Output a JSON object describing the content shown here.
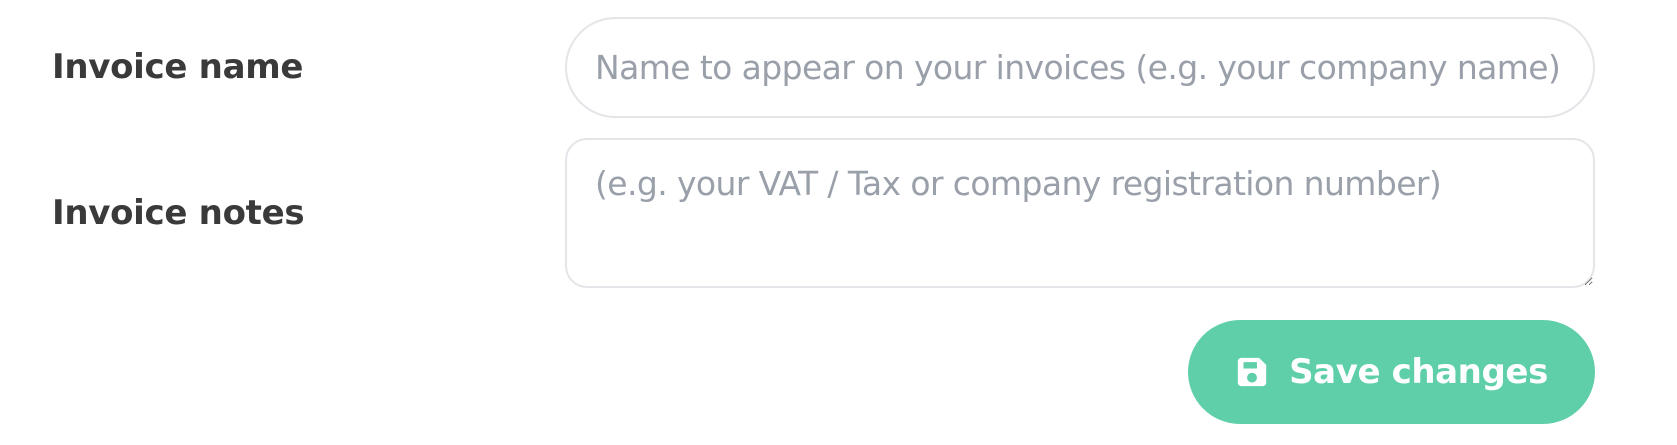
{
  "form": {
    "invoice_name": {
      "label": "Invoice name",
      "value": "",
      "placeholder": "Name to appear on your invoices (e.g. your company name)"
    },
    "invoice_notes": {
      "label": "Invoice notes",
      "value": "",
      "placeholder": "(e.g. your VAT / Tax or company registration number)"
    },
    "save_button": {
      "label": "Save changes",
      "icon": "floppy-disk-icon",
      "color": "#5fcfaa"
    }
  }
}
